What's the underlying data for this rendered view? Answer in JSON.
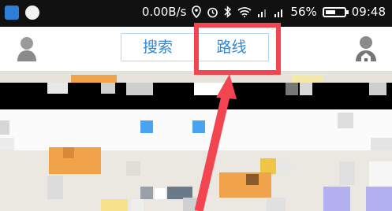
{
  "status_bar": {
    "speed": "0.00B/s",
    "battery_percent": "56%",
    "battery_level": 0.56,
    "time": "09:48",
    "icons": [
      "shield-icon",
      "qq-icon",
      "location-icon",
      "alarm-icon",
      "bluetooth-icon",
      "wifi-icon",
      "signal-icon",
      "signal-icon"
    ]
  },
  "header": {
    "tabs": [
      {
        "label": "搜索"
      },
      {
        "label": "路线"
      }
    ],
    "left_icon": "user-avatar-icon",
    "right_icon": "home-user-icon"
  },
  "colors": {
    "accent": "#2f88d8",
    "highlight": "#f2454f"
  }
}
